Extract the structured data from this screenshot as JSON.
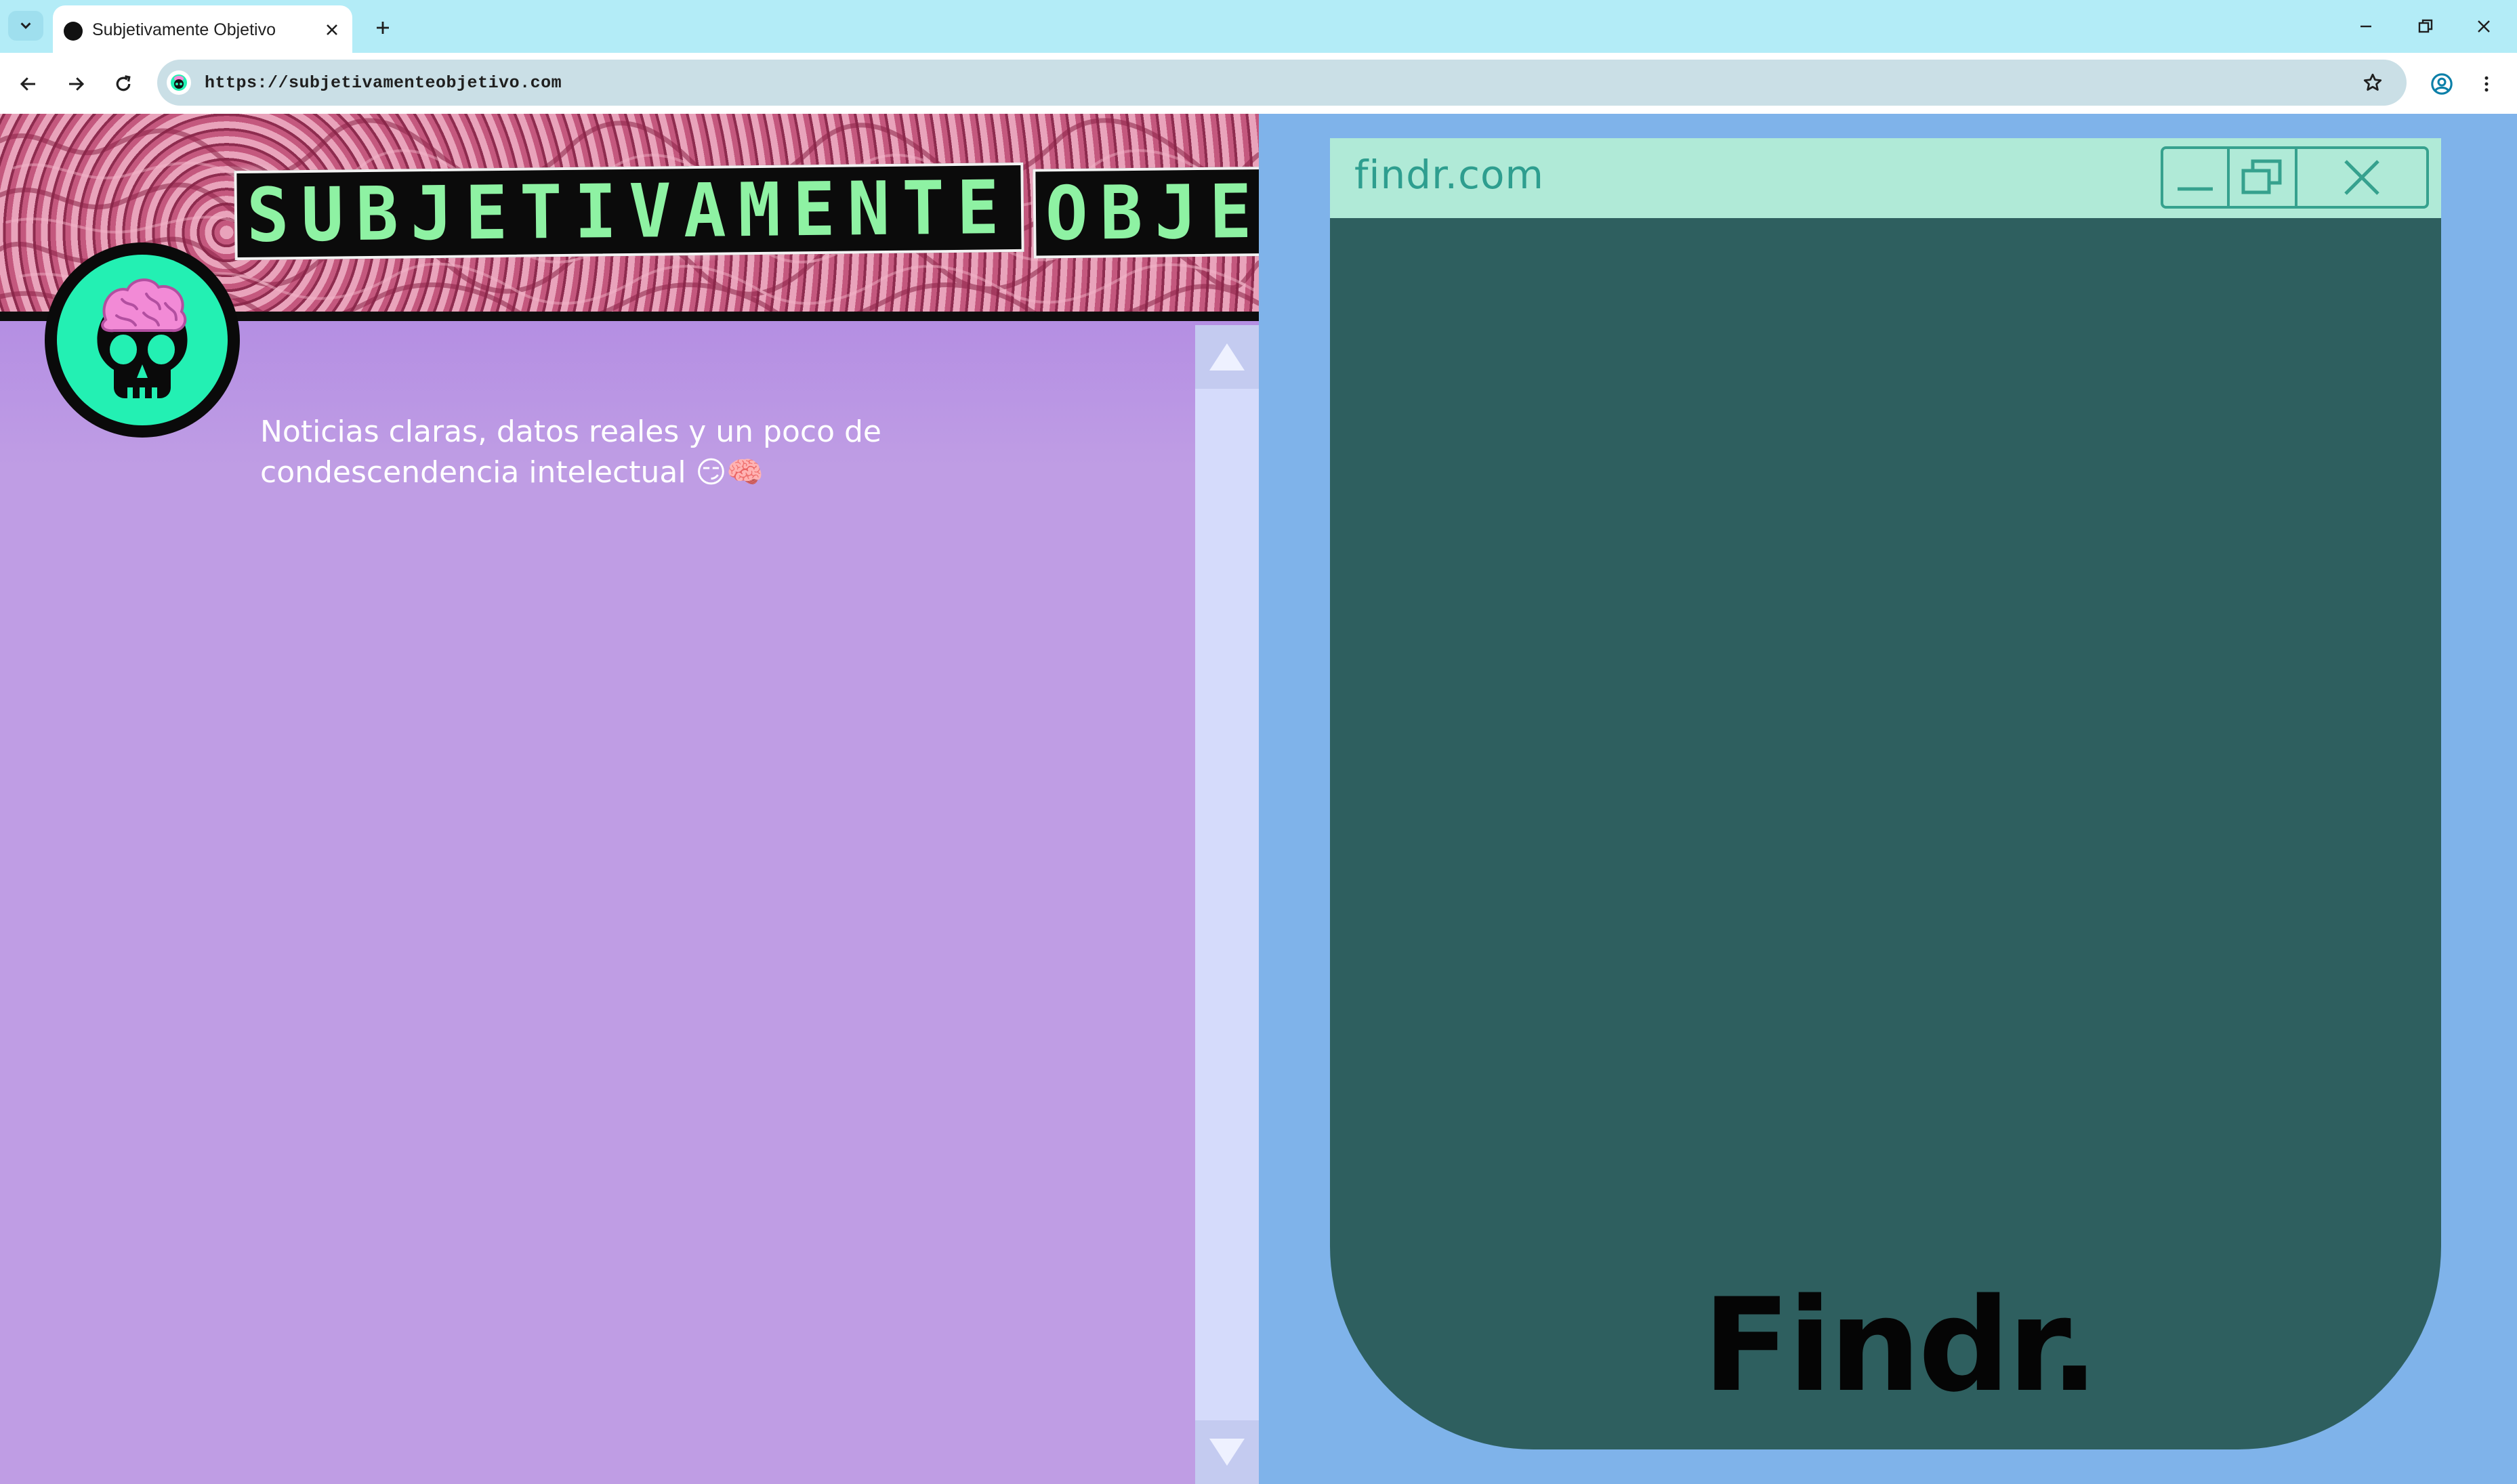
{
  "browser": {
    "tab_title": "Subjetivamente Objetivo",
    "url": "https://subjetivamenteobjetivo.com"
  },
  "page": {
    "title_word_1": "SUBJETIVAMENTE",
    "title_word_2": "OBJETIVO",
    "tagline": "Noticias claras, datos reales y un poco de condescendencia intelectual 😏🧠"
  },
  "findr": {
    "window_title": "findr.com",
    "logo_text": "Findr."
  },
  "colors": {
    "tabbar": "#b3ecf7",
    "page_purple_top": "#9a5ce0",
    "page_purple": "#bf9de4",
    "title_green": "#8ef2a3",
    "avatar_green": "#23f0b3",
    "findr_body": "#2e5f5f",
    "findr_bar": "#b0ead7",
    "findr_accent": "#36a18e",
    "desktop_blue": "#7fb3ea"
  }
}
